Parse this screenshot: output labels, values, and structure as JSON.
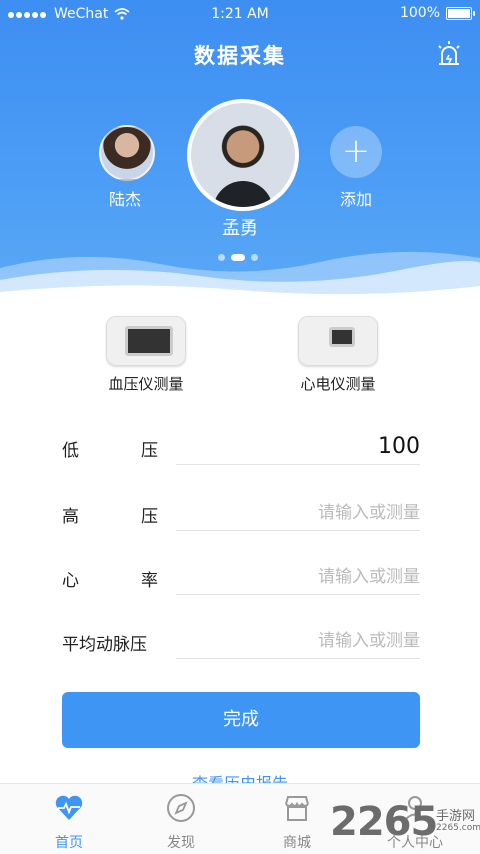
{
  "status": {
    "carrier": "WeChat",
    "time": "1:21 AM",
    "battery": "100%"
  },
  "header": {
    "title": "数据采集"
  },
  "users": {
    "left": "陆杰",
    "center": "孟勇",
    "add": "添加"
  },
  "devices": [
    {
      "label": "血压仪测量"
    },
    {
      "label": "心电仪测量"
    }
  ],
  "form": {
    "fields": [
      {
        "label_a": "低",
        "label_b": "压",
        "value": "100"
      },
      {
        "label_a": "高",
        "label_b": "压",
        "placeholder": "请输入或测量"
      },
      {
        "label_a": "心",
        "label_b": "率",
        "placeholder": "请输入或测量"
      },
      {
        "label": "平均动脉压",
        "placeholder": "请输入或测量"
      }
    ],
    "submit": "完成",
    "history_link": "查看历史报告"
  },
  "tabs": [
    {
      "label": "首页",
      "icon": "heartbeat-icon"
    },
    {
      "label": "发现",
      "icon": "compass-icon"
    },
    {
      "label": "商城",
      "icon": "store-icon"
    },
    {
      "label": "个人中心",
      "icon": "person-icon"
    }
  ],
  "watermark": {
    "big": "2265",
    "small": "手游网",
    "url": "2265.com"
  },
  "colors": {
    "primary": "#3f95f3"
  }
}
